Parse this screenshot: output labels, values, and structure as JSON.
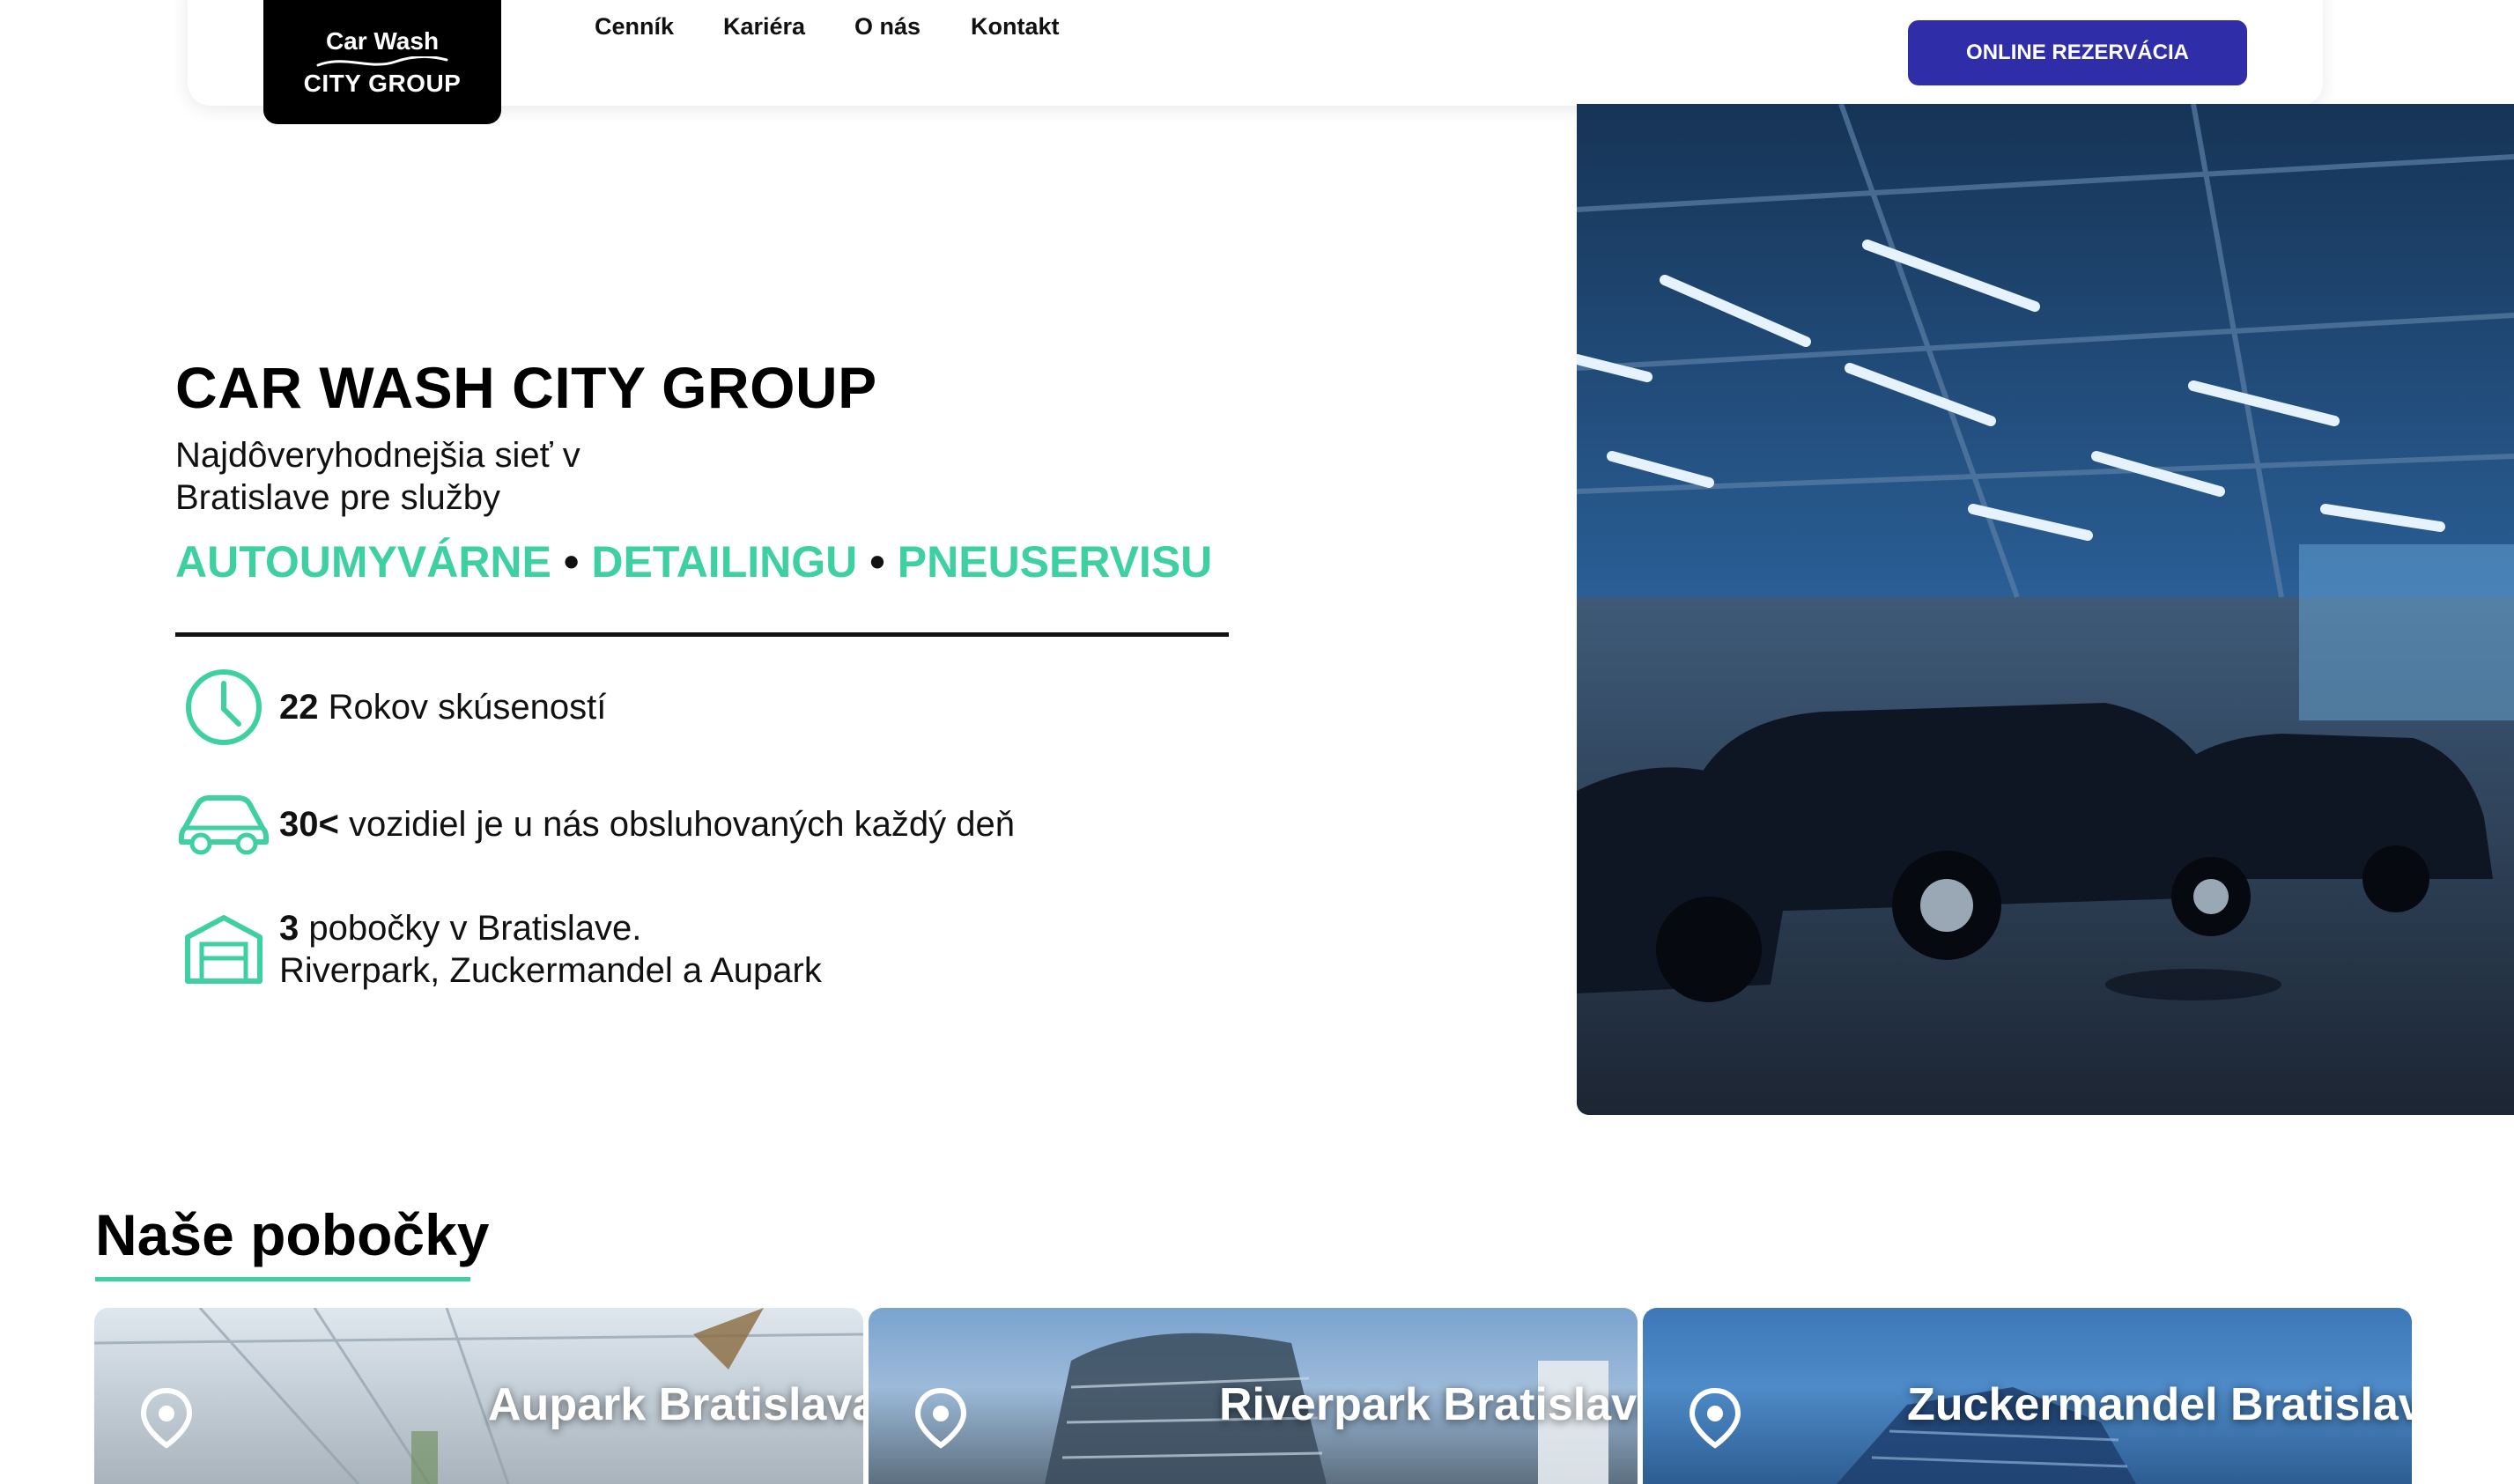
{
  "header": {
    "logo_line1": "Car Wash",
    "logo_line2": "CITY GROUP",
    "nav": [
      "Cenník",
      "Kariéra",
      "O nás",
      "Kontakt"
    ],
    "cta_label": "ONLINE REZERVÁCIA"
  },
  "hero": {
    "title": "CAR WASH CITY GROUP",
    "subtitle": "Najdôveryhodnejšia sieť v Bratislave pre služby",
    "services": [
      "AUTOUMYVÁRNE",
      "DETAILINGU",
      "PNEUSERVISU"
    ],
    "separator": "•",
    "features": [
      {
        "icon": "clock-icon",
        "bold": "22",
        "text": " Rokov skúseností"
      },
      {
        "icon": "car-icon",
        "bold": "30<",
        "text": " vozidiel je u nás obsluhovaných každý deň"
      },
      {
        "icon": "garage-icon",
        "bold": "3",
        "text": " pobočky v Bratislave.",
        "line2": "Riverpark, Zuckermandel a Aupark"
      }
    ]
  },
  "branches": {
    "title": "Naše pobočky",
    "items": [
      {
        "name": "Aupark Bratislava"
      },
      {
        "name": "Riverpark Bratislava"
      },
      {
        "name": "Zuckermandel Bratislava"
      }
    ]
  },
  "colors": {
    "accent": "#3ed0a0",
    "cta": "#2f2ea8",
    "logo_bg": "#000000"
  }
}
